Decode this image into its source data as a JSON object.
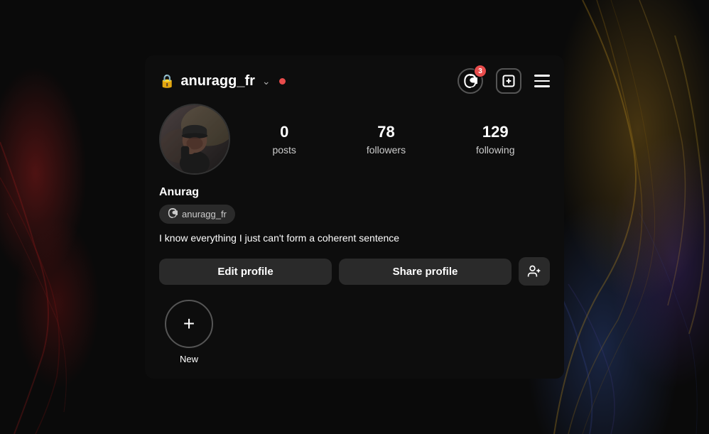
{
  "header": {
    "lock_icon": "🔒",
    "username": "anuragg_fr",
    "chevron": "∨",
    "threads_badge_count": "3",
    "add_button_label": "+",
    "menu_label": "menu"
  },
  "stats": {
    "posts_count": "0",
    "posts_label": "posts",
    "followers_count": "78",
    "followers_label": "followers",
    "following_count": "129",
    "following_label": "following"
  },
  "profile": {
    "display_name": "Anurag",
    "threads_handle": "anuragg_fr",
    "bio": "I know everything I just can't form a coherent sentence"
  },
  "buttons": {
    "edit_profile": "Edit profile",
    "share_profile": "Share profile",
    "add_person_icon": "👤+"
  },
  "story": {
    "new_label": "New",
    "plus_icon": "+"
  },
  "colors": {
    "background": "#0d0d0d",
    "notification": "#e84c4c",
    "button_bg": "#2a2a2a",
    "text_primary": "#ffffff",
    "text_secondary": "#cccccc"
  }
}
